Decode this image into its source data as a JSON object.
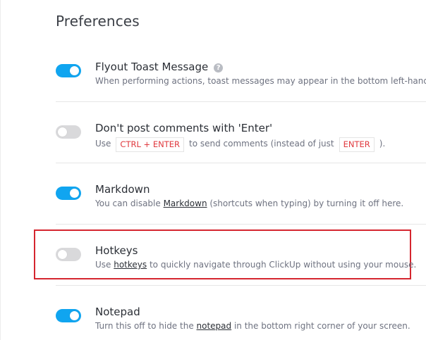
{
  "page": {
    "title": "Preferences"
  },
  "preferences": [
    {
      "title": "Flyout Toast Message",
      "enabled": true,
      "has_help": true,
      "help_icon": "question-circle-icon",
      "description": "When performing actions, toast messages may appear in the bottom left-hand c"
    },
    {
      "title": "Don't post comments with 'Enter'",
      "enabled": false,
      "desc_parts": {
        "prefix": "Use",
        "key1": "CTRL + ENTER",
        "middle": "to send comments (instead of just",
        "key2": "ENTER",
        "suffix": ")."
      }
    },
    {
      "title": "Markdown",
      "enabled": true,
      "desc_parts": {
        "prefix": "You can disable ",
        "link": "Markdown",
        "suffix": " (shortcuts when typing) by turning it off here."
      }
    },
    {
      "title": "Hotkeys",
      "enabled": false,
      "highlighted": true,
      "desc_parts": {
        "prefix": "Use ",
        "link": "hotkeys",
        "suffix": " to quickly navigate through ClickUp without using your mouse."
      }
    },
    {
      "title": "Notepad",
      "enabled": true,
      "desc_parts": {
        "prefix": "Turn this off to hide the ",
        "link": "notepad",
        "suffix": " in the bottom right corner of your screen."
      }
    }
  ],
  "colors": {
    "toggle_on": "#10a5f0",
    "toggle_off": "#d9d9db",
    "key_text": "#e0393e",
    "highlight_border": "#d5262f"
  }
}
